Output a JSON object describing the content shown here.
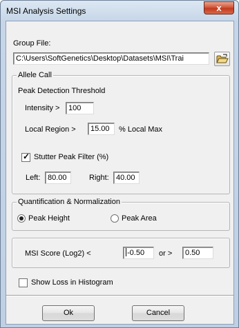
{
  "window": {
    "title": "MSI Analysis Settings",
    "close_glyph": "x"
  },
  "group_file": {
    "label": "Group File:",
    "path": "C:\\Users\\SoftGenetics\\Desktop\\Datasets\\MSI\\Trai",
    "browse_icon": "folder-open-icon"
  },
  "allele_call": {
    "legend": "Allele Call",
    "peak_detection_label": "Peak Detection Threshold",
    "intensity_label": "Intensity >",
    "intensity_value": "100",
    "local_region_label": "Local Region >",
    "local_region_value": "15.00",
    "local_max_label": "% Local Max",
    "stutter_label": "Stutter Peak Filter (%)",
    "stutter_checked": true,
    "left_label": "Left:",
    "left_value": "80.00",
    "right_label": "Right:",
    "right_value": "40.00"
  },
  "quantification": {
    "legend": "Quantification & Normalization",
    "peak_height_label": "Peak Height",
    "peak_area_label": "Peak Area",
    "selected": "Peak Height"
  },
  "msi_score": {
    "label": "MSI Score (Log2)  <",
    "lower_value": "-0.50",
    "or_label": "or  >",
    "upper_value": "0.50"
  },
  "show_loss": {
    "label": "Show Loss in Histogram",
    "checked": false
  },
  "buttons": {
    "ok": "Ok",
    "cancel": "Cancel"
  }
}
